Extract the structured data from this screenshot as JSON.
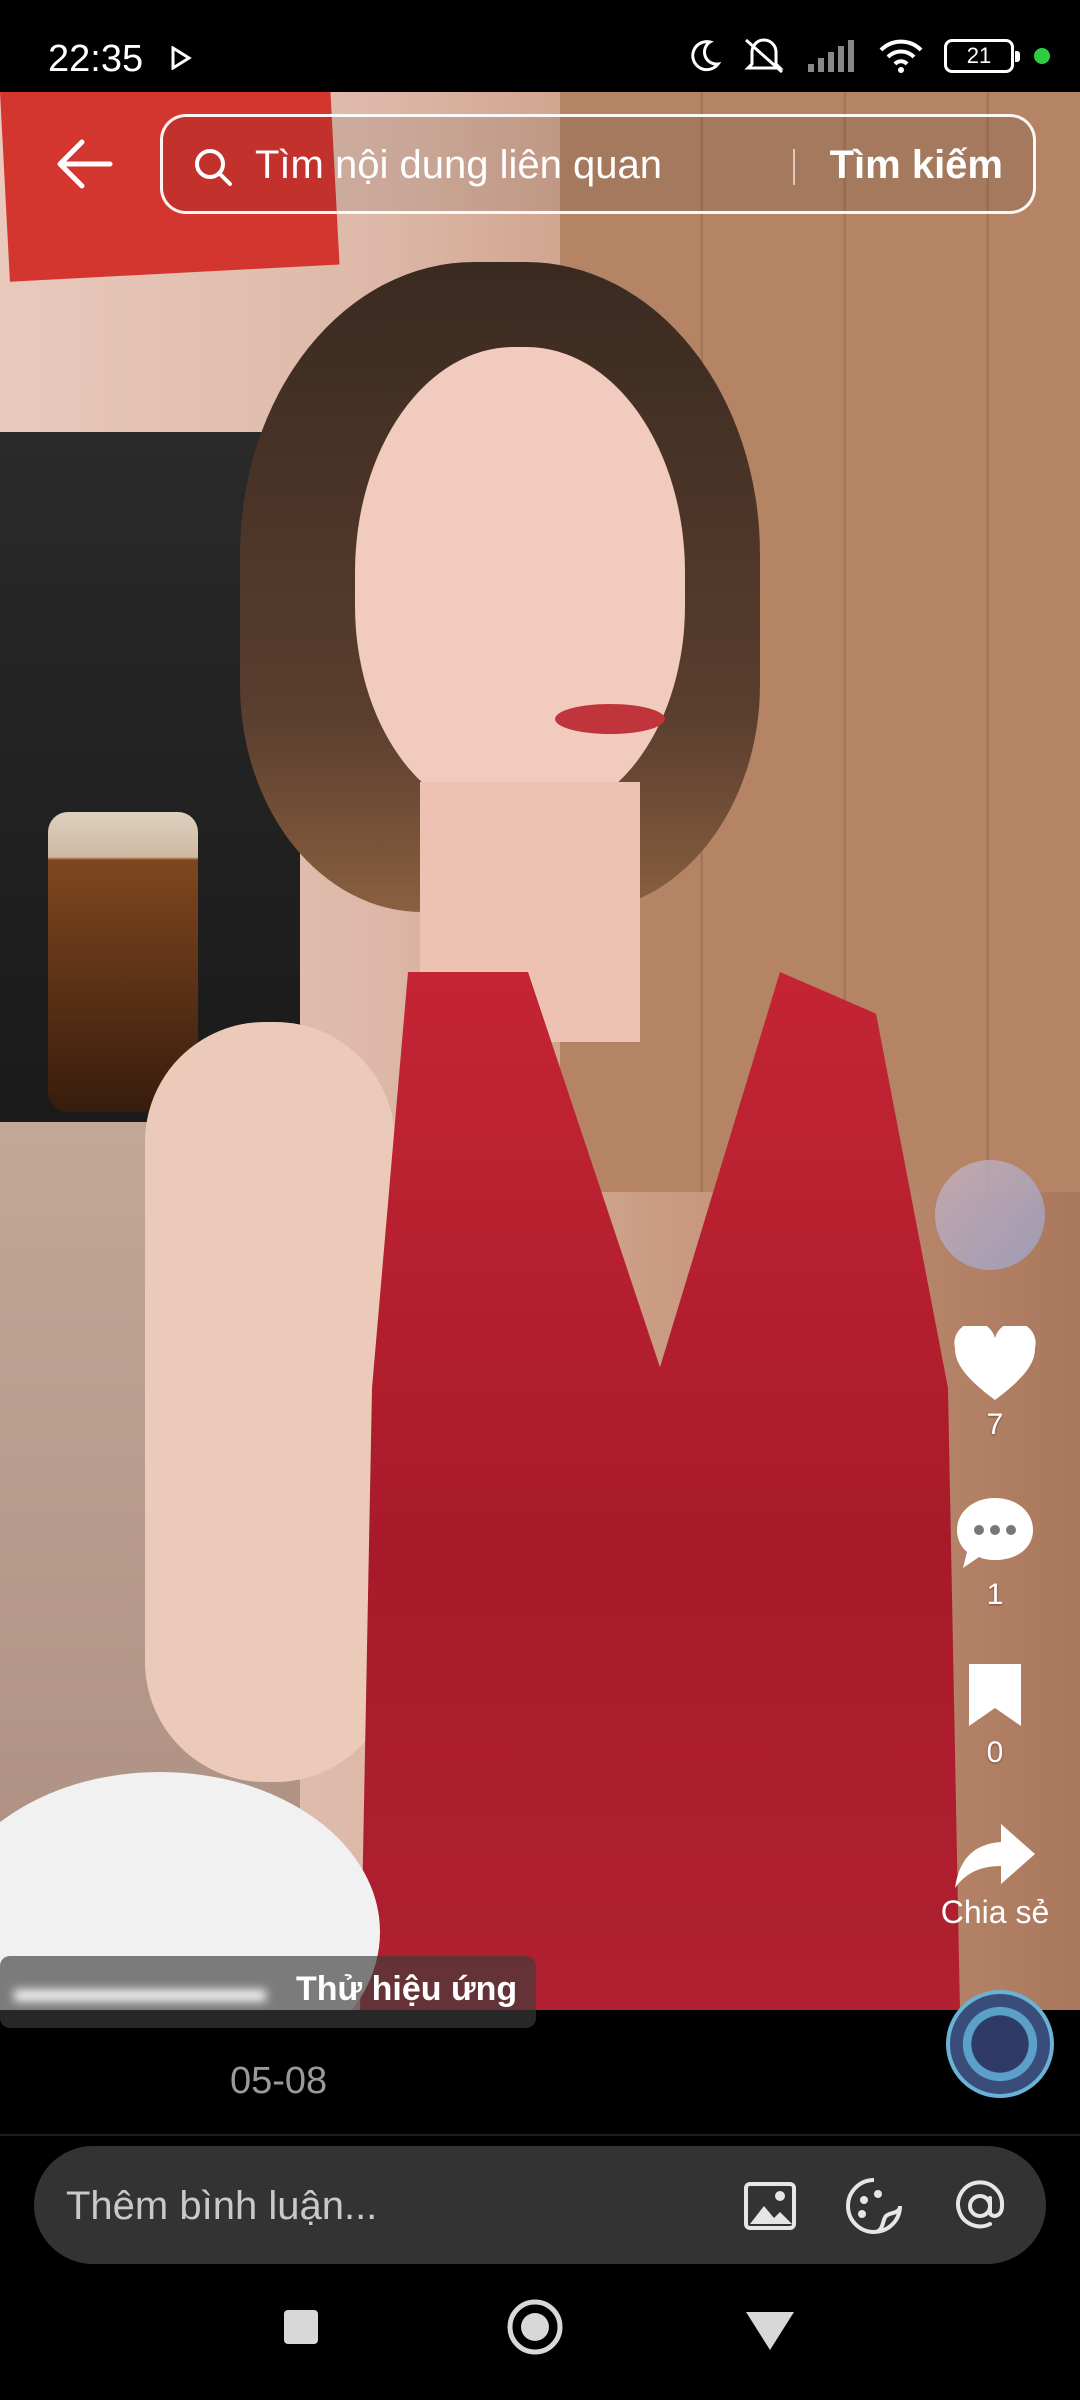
{
  "status_bar": {
    "time": "22:35",
    "battery": "21",
    "icons": [
      "play-icon",
      "moon-icon",
      "mute-icon",
      "signal-icon",
      "wifi-icon",
      "battery-icon"
    ],
    "dot_color": "#2ecc40"
  },
  "search": {
    "placeholder": "Tìm nội dung liên quan",
    "button_label": "Tìm kiếm"
  },
  "actions": {
    "likes": "7",
    "comments": "1",
    "saves": "0",
    "share_label": "Chia sẻ"
  },
  "caption": {
    "effect_label": "Thử hiệu ứng",
    "date": "05-08"
  },
  "comment_bar": {
    "placeholder": "Thêm bình luận..."
  },
  "colors": {
    "accent_green": "#2ecc40",
    "comment_bg": "#333333"
  }
}
